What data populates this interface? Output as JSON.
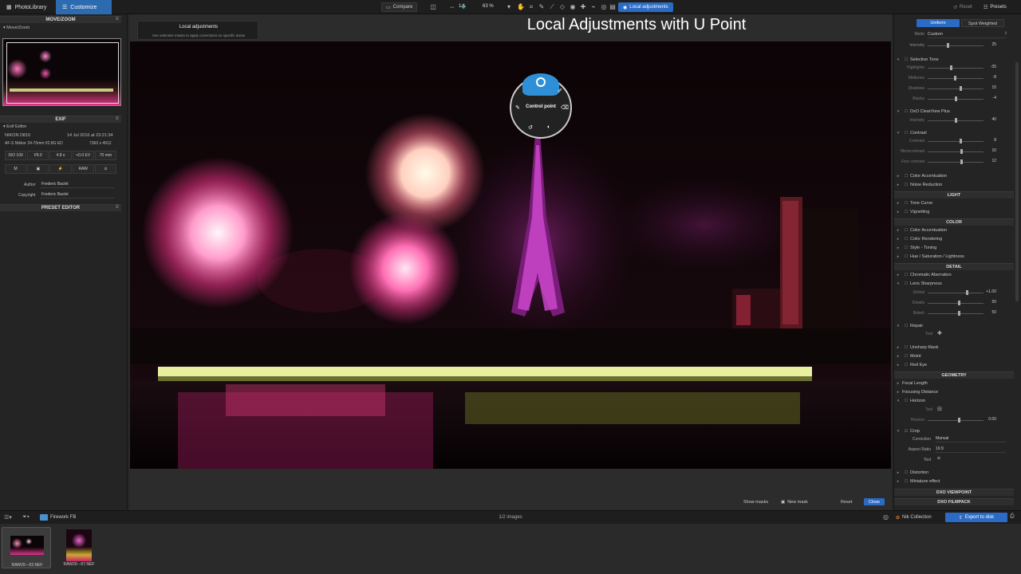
{
  "tabs": {
    "photolibrary": "PhotoLibrary",
    "customize": "Customize"
  },
  "toolbar": {
    "compare": "Compare",
    "zoom_fit": "1:1",
    "zoom_pct": "63 %",
    "local_adj": "Local adjustments",
    "reset": "Reset",
    "presets": "Presets"
  },
  "overlay_title": "Local Adjustments with U Point",
  "tooltip": {
    "title": "Local adjustments",
    "desc": "Use selective masks to apply corrections on specific areas"
  },
  "control_point": {
    "label": "Control point"
  },
  "left": {
    "movezoom": {
      "header": "MOVE/ZOOM",
      "sub": "Move/Zoom"
    },
    "exif": {
      "header": "EXIF",
      "sub": "Exif Editor",
      "camera": "NIKON D810",
      "date": "14 Jul 2016 at 23:21:34",
      "lens": "AF-S Nikkor 24-70mm f/2.8G ED",
      "dims": "7360 x 4912",
      "iso": "ISO 100",
      "aperture": "f/9.0",
      "shutter": "4.8 s",
      "ev": "+0.0 EV",
      "focal": "70 mm",
      "raw": "RAW",
      "author_label": "Author",
      "author": "Frederic Baclet",
      "copyright_label": "Copyright",
      "copyright": "Frederic Baclet"
    },
    "preset": {
      "header": "PRESET EDITOR"
    }
  },
  "right": {
    "uniform": "Uniform",
    "spot": "Spot Weighted",
    "mode_label": "Mode",
    "mode": "Custom",
    "intensity_label": "Intensity",
    "intensity": "25",
    "selective_tone": "Selective Tone",
    "highlights": "Highlights",
    "highlights_v": "-35",
    "midtones": "Midtones",
    "midtones_v": "-8",
    "shadows": "Shadows",
    "shadows_v": "15",
    "blacks": "Blacks",
    "blacks_v": "-4",
    "clearview": "DxO ClearView Plus",
    "cv_intensity": "Intensity",
    "cv_intensity_v": "40",
    "contrast": "Contrast",
    "contrast_c": "Contrast",
    "contrast_c_v": "8",
    "microcontrast": "Microcontrast",
    "microcontrast_v": "10",
    "finecontrast": "Fine contrast",
    "finecontrast_v": "12",
    "color_accent": "Color Accentuation",
    "noise": "Noise Reduction",
    "light": "LIGHT",
    "tonecurve": "Tone Curve",
    "vignetting": "Vignetting",
    "color": "COLOR",
    "color_accent2": "Color Accentuation",
    "color_render": "Color Rendering",
    "style_toning": "Style - Toning",
    "hsl": "Hue / Saturation / Lightness",
    "detail": "DETAIL",
    "chromatic": "Chromatic Aberration",
    "lens_sharp": "Lens Sharpness",
    "global": "Global",
    "global_v": "+1.00",
    "details": "Details",
    "details_v": "50",
    "bokeh": "Bokeh",
    "bokeh_v": "50",
    "repair": "Repair",
    "tool": "Tool",
    "unsharp": "Unsharp Mask",
    "moire": "Moiré",
    "redeye": "Red Eye",
    "geometry": "GEOMETRY",
    "focal_len": "Focal Length",
    "focusing": "Focusing Distance",
    "horizon": "Horizon",
    "horizon_tool": "Tool",
    "horizon_h": "Horizon",
    "horizon_v": "0.00",
    "crop": "Crop",
    "correction_label": "Correction",
    "correction": "Manual",
    "aspect_label": "Aspect Ratio",
    "aspect": "16:9",
    "crop_tool": "Tool",
    "distortion": "Distortion",
    "miniature": "Miniature effect",
    "viewpoint": "DXO VIEWPOINT",
    "filmpack": "DXO FILMPACK"
  },
  "viewer_bottom": {
    "show_masks": "Show masks",
    "new_mask": "New mask",
    "reset": "Reset",
    "close": "Close"
  },
  "bottombar": {
    "folder": "Firework FB",
    "count": "1/2 images",
    "nik": "Nik Collection",
    "export": "Export to disk"
  },
  "filmstrip": [
    {
      "name": "RAW20---02.NEF"
    },
    {
      "name": "RAW20---07.NEF"
    }
  ]
}
